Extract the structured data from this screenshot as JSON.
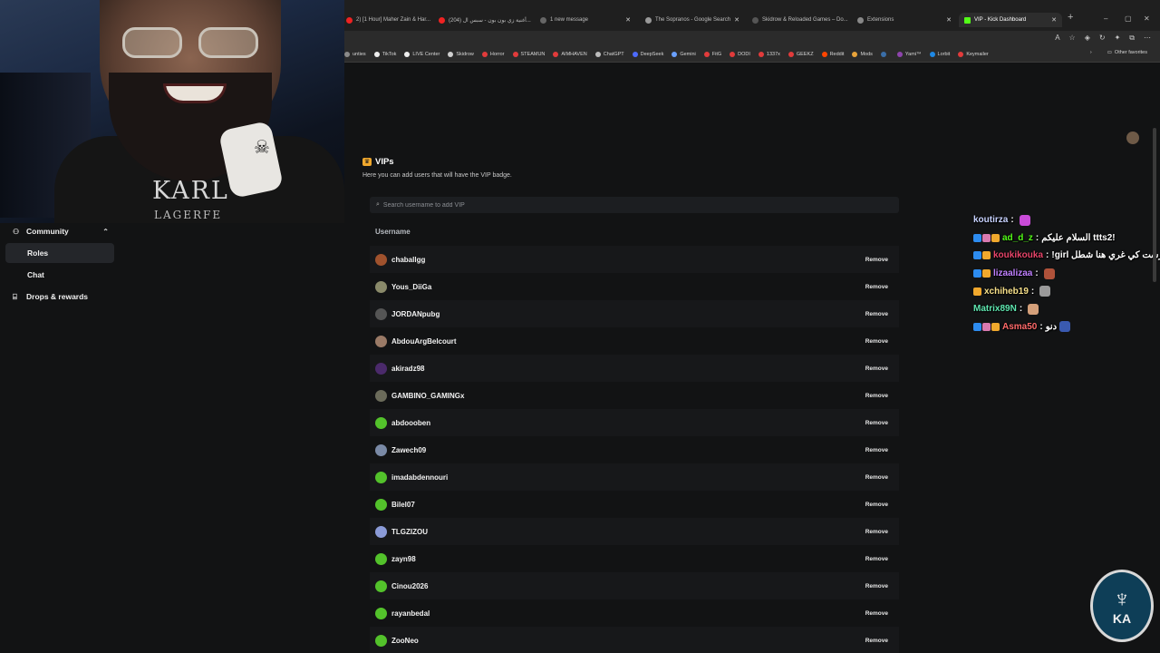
{
  "browser": {
    "tabs": [
      {
        "label": "2) [1 Hour] Maher Zain & Har...",
        "active": false
      },
      {
        "label": "(204) أغنية زي بون بون - سبس ال...",
        "active": false
      },
      {
        "label": "1 new message",
        "active": false
      },
      {
        "label": "The Sopranos - Google Search",
        "active": false
      },
      {
        "label": "Skidrow & Reloaded Games – Do...",
        "active": false
      },
      {
        "label": "Extensions",
        "active": false
      },
      {
        "label": "VIP - Kick Dashboard",
        "active": true
      }
    ],
    "new_tab": "+",
    "window_controls": {
      "minimize": "–",
      "maximize": "▢",
      "close": "✕"
    },
    "bookmarks": [
      "unties",
      "TikTok",
      "LIVE Center",
      "Skidrow",
      "Horror",
      "STEAMUN",
      "AIMHAVEN",
      "ChatGPT",
      "DeepSeek",
      "Gemini",
      "FitG",
      "DODI",
      "1337x",
      "GEEKZ",
      "Reddit",
      "Mods",
      "",
      "Yami™",
      "Lorbit",
      "Keymailer"
    ],
    "bookmark_colors": [
      "#8a8a8a",
      "#eeeeee",
      "#eeeeee",
      "#cfcfcf",
      "#e23b3b",
      "#e23b3b",
      "#e23b3b",
      "#bdbdbd",
      "#4d6bfe",
      "#6aa0ff",
      "#e23b3b",
      "#e23b3b",
      "#e23b3b",
      "#e23b3b",
      "#ff4500",
      "#e8a33a",
      "#3a6ea8",
      "#8e44ad",
      "#1e88e5",
      "#e23b3b"
    ],
    "overflow_chevron": "›",
    "other_favorites": "Other favorites"
  },
  "sidebar": {
    "community": {
      "label": "Community",
      "icon": "community-icon",
      "chevron": "⌃"
    },
    "items": [
      {
        "label": "Roles",
        "selected": true
      },
      {
        "label": "Chat",
        "selected": false
      }
    ],
    "drops": {
      "label": "Drops & rewards",
      "icon": "gift-icon"
    }
  },
  "webcam": {
    "shirt_text_1": "KARL",
    "shirt_text_2": "LAGERFE"
  },
  "vip": {
    "title": "VIPs",
    "description": "Here you can add users that will have the VIP badge.",
    "search_placeholder": "Search username to add VIP",
    "column_username": "Username",
    "remove_label": "Remove",
    "users": [
      {
        "name": "chaballgg",
        "avatar_color": "#a0522d"
      },
      {
        "name": "Yous_DiiGa",
        "avatar_color": "#8a8a6a"
      },
      {
        "name": "JORDANpubg",
        "avatar_color": "#555555"
      },
      {
        "name": "AbdouArgBelcourt",
        "avatar_color": "#9a7a66"
      },
      {
        "name": "akiradz98",
        "avatar_color": "#4b2a6b"
      },
      {
        "name": "GAMBINO_GAMINGx",
        "avatar_color": "#6b6b5a"
      },
      {
        "name": "abdoooben",
        "avatar_color": "#53c22b"
      },
      {
        "name": "Zawech09",
        "avatar_color": "#7a8aa6"
      },
      {
        "name": "imadabdennouri",
        "avatar_color": "#53c22b"
      },
      {
        "name": "Bilel07",
        "avatar_color": "#53c22b"
      },
      {
        "name": "TLGZIZOU",
        "avatar_color": "#8b9bd8"
      },
      {
        "name": "zayn98",
        "avatar_color": "#53c22b"
      },
      {
        "name": "Cinou2026",
        "avatar_color": "#53c22b"
      },
      {
        "name": "rayanbedal",
        "avatar_color": "#53c22b"
      },
      {
        "name": "ZooNeo",
        "avatar_color": "#53c22b"
      }
    ]
  },
  "chat": {
    "messages": [
      {
        "user": "koutirza",
        "user_color": "#c7d2ff",
        "badges": [],
        "text": "",
        "emote_color": "#c94bd8"
      },
      {
        "user": "ad_d_z",
        "user_color": "#53fc18",
        "badges": [
          "#2d8cf0",
          "#d97ab0",
          "#f0a82d"
        ],
        "text": "السلام عليكم ttts2!",
        "emote_color": ""
      },
      {
        "user": "koukikouka",
        "user_color": "#e8456a",
        "badges": [
          "#2d8cf0",
          "#f0a82d"
        ],
        "text": "!girl تضرست كي غري هنا شطل",
        "emote_color": ""
      },
      {
        "user": "lizaalizaa",
        "user_color": "#c080ff",
        "badges": [
          "#2d8cf0",
          "#f0a82d"
        ],
        "text": "",
        "emote_color": "#b0523a"
      },
      {
        "user": "xchiheb19",
        "user_color": "#f7e08a",
        "badges": [
          "#f0a82d"
        ],
        "text": "",
        "emote_color": "#9a9a9a"
      },
      {
        "user": "Matrix89N",
        "user_color": "#5fe6b0",
        "badges": [],
        "text": "",
        "emote_color": "#d4a07a"
      },
      {
        "user": "Asma50",
        "user_color": "#ff6a6a",
        "badges": [
          "#2d8cf0",
          "#d97ab0",
          "#f0a82d"
        ],
        "text": "دنو",
        "emote_color": "#3a5ab0"
      }
    ]
  },
  "logo": {
    "mono": "KA"
  }
}
